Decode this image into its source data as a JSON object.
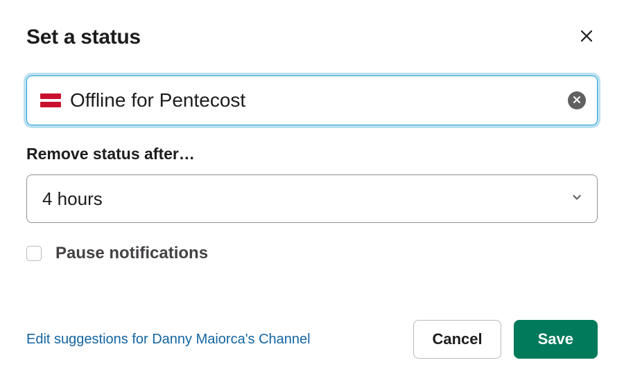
{
  "dialog": {
    "title": "Set a status",
    "status_text": "Offline for Pentecost",
    "emoji_name": "flag-denmark",
    "remove_after_label": "Remove status after…",
    "remove_after_value": "4 hours",
    "pause_notifications_label": "Pause notifications",
    "pause_notifications_checked": false,
    "edit_suggestions_link": "Edit suggestions for Danny Maiorca's Channel",
    "cancel_label": "Cancel",
    "save_label": "Save"
  }
}
